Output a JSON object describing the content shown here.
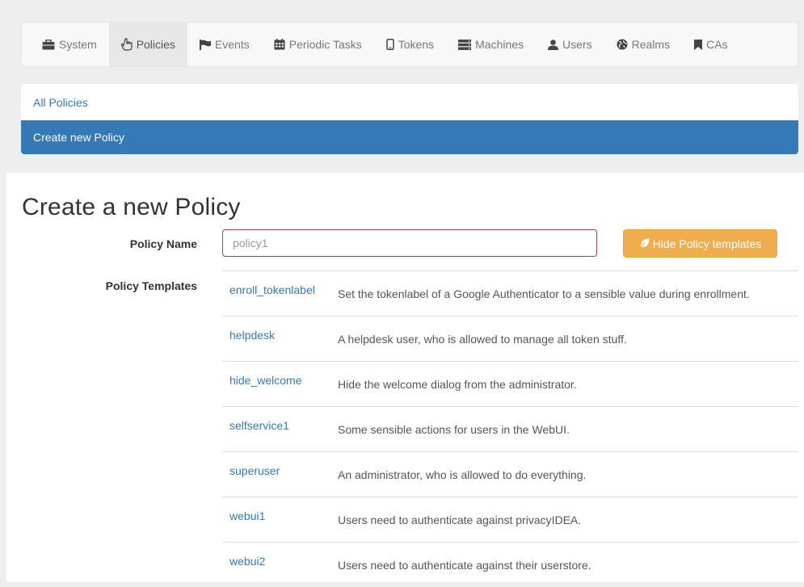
{
  "navbar": {
    "items": [
      {
        "label": "System",
        "icon": "briefcase-icon",
        "active": false
      },
      {
        "label": "Policies",
        "icon": "hand-pointer-icon",
        "active": true
      },
      {
        "label": "Events",
        "icon": "flag-icon",
        "active": false
      },
      {
        "label": "Periodic Tasks",
        "icon": "calendar-icon",
        "active": false
      },
      {
        "label": "Tokens",
        "icon": "phone-icon",
        "active": false
      },
      {
        "label": "Machines",
        "icon": "server-icon",
        "active": false
      },
      {
        "label": "Users",
        "icon": "user-icon",
        "active": false
      },
      {
        "label": "Realms",
        "icon": "globe-icon",
        "active": false
      },
      {
        "label": "CAs",
        "icon": "bookmark-icon",
        "active": false
      }
    ]
  },
  "subnav": {
    "all_policies": "All Policies",
    "create_new": "Create new Policy"
  },
  "form": {
    "title": "Create a new Policy",
    "policy_name_label": "Policy Name",
    "policy_name_placeholder": "policy1",
    "templates_label": "Policy Templates",
    "toggle_templates_button": "Hide Policy templates"
  },
  "templates": [
    {
      "name": "enroll_tokenlabel",
      "description": "Set the tokenlabel of a Google Authenticator to a sensible value during enrollment."
    },
    {
      "name": "helpdesk",
      "description": "A helpdesk user, who is allowed to manage all token stuff."
    },
    {
      "name": "hide_welcome",
      "description": "Hide the welcome dialog from the administrator."
    },
    {
      "name": "selfservice1",
      "description": "Some sensible actions for users in the WebUI."
    },
    {
      "name": "superuser",
      "description": "An administrator, who is allowed to do everything."
    },
    {
      "name": "webui1",
      "description": "Users need to authenticate against privacyIDEA."
    },
    {
      "name": "webui2",
      "description": "Users need to authenticate against their userstore."
    }
  ],
  "colors": {
    "primary": "#337ab7",
    "warning": "#f0ad4e",
    "error_border": "#a94442"
  }
}
